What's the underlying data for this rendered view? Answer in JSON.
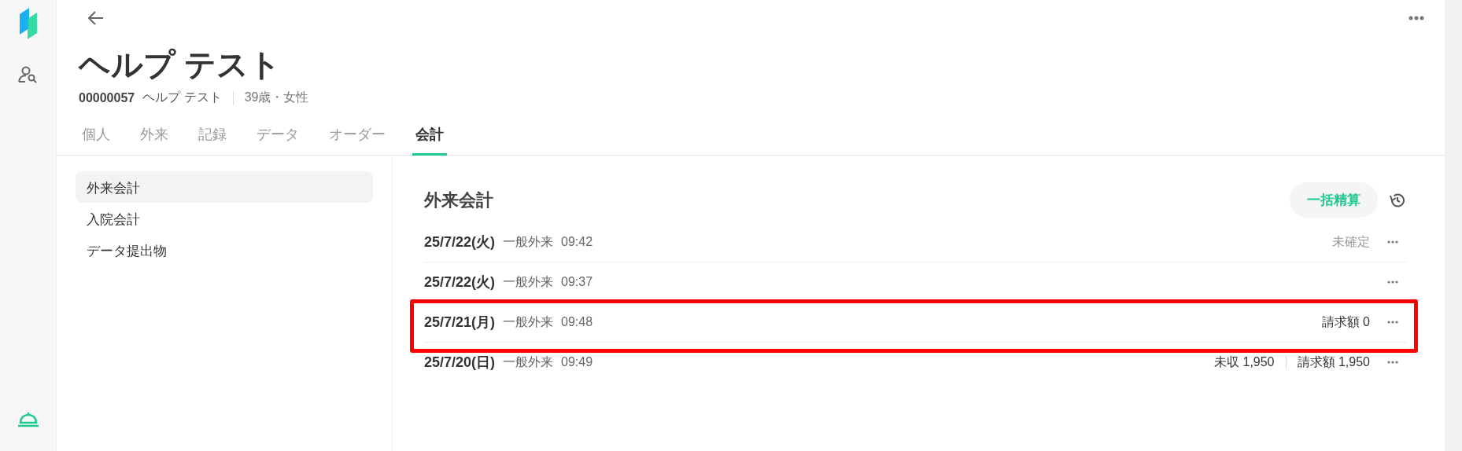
{
  "patient": {
    "name": "ヘルプ テスト",
    "id": "00000057",
    "kana": "ヘルプ テスト",
    "age_sex": "39歳・女性"
  },
  "tabs": [
    {
      "label": "個人",
      "selected": false
    },
    {
      "label": "外来",
      "selected": false
    },
    {
      "label": "記録",
      "selected": false
    },
    {
      "label": "データ",
      "selected": false
    },
    {
      "label": "オーダー",
      "selected": false
    },
    {
      "label": "会計",
      "selected": true
    }
  ],
  "sidebar": {
    "items": [
      {
        "label": "外来会計",
        "selected": true
      },
      {
        "label": "入院会計",
        "selected": false
      },
      {
        "label": "データ提出物",
        "selected": false
      }
    ]
  },
  "section": {
    "title": "外来会計",
    "button": "一括精算"
  },
  "visits": [
    {
      "date": "25/7/22(火)",
      "type": "一般外来",
      "time": "09:42",
      "highlighted": false,
      "info": [
        {
          "text": "未確定",
          "kind": "status"
        }
      ]
    },
    {
      "date": "25/7/22(火)",
      "type": "一般外来",
      "time": "09:37",
      "highlighted": false
    },
    {
      "date": "25/7/21(月)",
      "type": "一般外来",
      "time": "09:48",
      "highlighted": true,
      "info": [
        {
          "text": "請求額 0",
          "kind": "amount"
        }
      ]
    },
    {
      "date": "25/7/20(日)",
      "type": "一般外来",
      "time": "09:49",
      "highlighted": false,
      "info": [
        {
          "text": "未収 1,950",
          "kind": "amount"
        },
        {
          "text": "請求額 1,950",
          "kind": "amount"
        }
      ]
    }
  ]
}
